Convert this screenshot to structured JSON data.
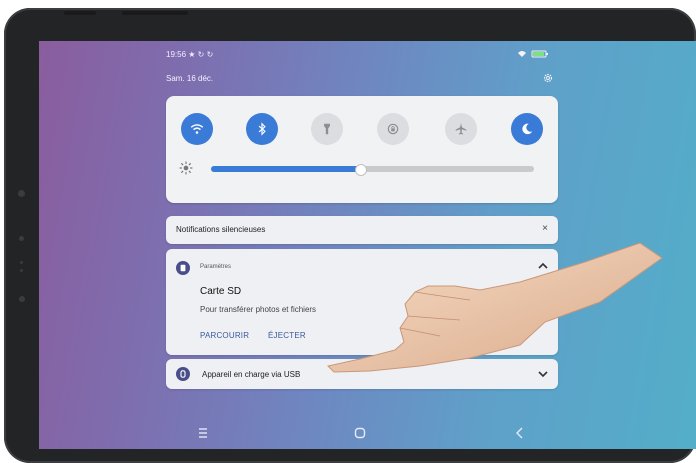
{
  "status_bar": {
    "time": "19:56",
    "left_icons": "★ ↻ ↻",
    "right_icons": [
      "wifi-signal-icon",
      "battery-icon"
    ]
  },
  "header": {
    "date": "Sam. 16 déc."
  },
  "quick_settings": {
    "tiles": [
      {
        "icon": "wifi-icon",
        "on": true
      },
      {
        "icon": "bluetooth-icon",
        "on": true
      },
      {
        "icon": "flashlight-icon",
        "on": false
      },
      {
        "icon": "rotation-lock-icon",
        "on": false
      },
      {
        "icon": "airplane-mode-icon",
        "on": false
      },
      {
        "icon": "night-mode-icon",
        "on": true
      }
    ],
    "brightness": 0.46
  },
  "silent_notifications": {
    "title": "Notifications silencieuses",
    "close": "×"
  },
  "notification": {
    "app": "Paramètres",
    "title": "Carte SD",
    "text": "Pour transférer photos et fichiers",
    "actions": [
      "PARCOURIR",
      "ÉJECTER"
    ]
  },
  "usb_notification": {
    "title": "Appareil en charge via USB"
  },
  "colors": {
    "accent": "#3a7bd8",
    "card": "#eff0f3",
    "action_text": "#3a5b9e"
  },
  "nav_bar": {
    "items": [
      "recent-apps-icon",
      "home-icon",
      "back-icon"
    ]
  }
}
